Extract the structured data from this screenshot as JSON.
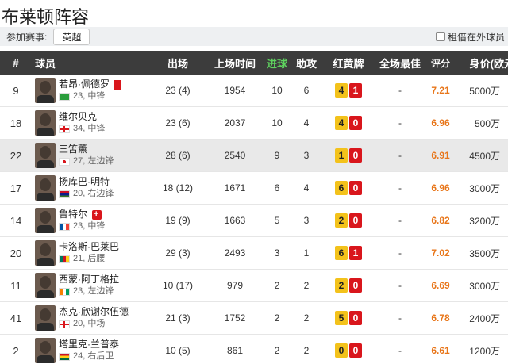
{
  "page_title": "布莱顿阵容",
  "filter": {
    "label": "参加赛事:",
    "league_button": "英超",
    "loan_checkbox_label": "租借在外球员"
  },
  "columns": {
    "num": "#",
    "player": "球员",
    "appearances": "出场",
    "minutes": "上场时间",
    "goals": "进球",
    "assists": "助攻",
    "cards": "红黄牌",
    "best": "全场最佳",
    "rating": "评分",
    "value": "身价(欧元)"
  },
  "colors": {
    "header_bg": "#3c3c3c",
    "goals_header": "#5fd35f",
    "yellow_card": "#f3c21b",
    "red_card": "#d9161c",
    "rating": "#e8761a",
    "trend_up": "#d9161c",
    "trend_flat": "#999999"
  },
  "players": [
    {
      "num": "9",
      "name": "若昂·佩德罗",
      "badge": "red-card",
      "flag": "brazil",
      "meta": "23, 中锋",
      "appearances": "23 (4)",
      "minutes": "1954",
      "goals": "10",
      "assists": "6",
      "yellow": "4",
      "red": "1",
      "best": "-",
      "rating": "7.21",
      "value": "5000万",
      "trend": "flat"
    },
    {
      "num": "18",
      "name": "维尔贝克",
      "badge": "",
      "flag": "england",
      "meta": "34, 中锋",
      "appearances": "23 (6)",
      "minutes": "2037",
      "goals": "10",
      "assists": "4",
      "yellow": "4",
      "red": "0",
      "best": "-",
      "rating": "6.96",
      "value": "500万",
      "trend": "flat"
    },
    {
      "num": "22",
      "name": "三笘薰",
      "badge": "",
      "flag": "japan",
      "meta": "27, 左边锋",
      "appearances": "28 (6)",
      "minutes": "2540",
      "goals": "9",
      "assists": "3",
      "yellow": "1",
      "red": "0",
      "best": "-",
      "rating": "6.91",
      "value": "4500万",
      "trend": "flat"
    },
    {
      "num": "17",
      "name": "扬库巴·明特",
      "badge": "",
      "flag": "gambia",
      "meta": "20, 右边锋",
      "appearances": "18 (12)",
      "minutes": "1671",
      "goals": "6",
      "assists": "4",
      "yellow": "6",
      "red": "0",
      "best": "-",
      "rating": "6.96",
      "value": "3000万",
      "trend": "up"
    },
    {
      "num": "14",
      "name": "鲁特尔",
      "badge": "injury",
      "flag": "france",
      "meta": "23, 中锋",
      "appearances": "19 (9)",
      "minutes": "1663",
      "goals": "5",
      "assists": "3",
      "yellow": "2",
      "red": "0",
      "best": "-",
      "rating": "6.82",
      "value": "3200万",
      "trend": "up"
    },
    {
      "num": "20",
      "name": "卡洛斯·巴莱巴",
      "badge": "",
      "flag": "cameroon",
      "meta": "21, 后腰",
      "appearances": "29 (3)",
      "minutes": "2493",
      "goals": "3",
      "assists": "1",
      "yellow": "6",
      "red": "1",
      "best": "-",
      "rating": "7.02",
      "value": "3500万",
      "trend": "up"
    },
    {
      "num": "11",
      "name": "西蒙·阿丁格拉",
      "badge": "",
      "flag": "ivory-coast",
      "meta": "23, 左边锋",
      "appearances": "10 (17)",
      "minutes": "979",
      "goals": "2",
      "assists": "2",
      "yellow": "2",
      "red": "0",
      "best": "-",
      "rating": "6.69",
      "value": "3000万",
      "trend": "up"
    },
    {
      "num": "41",
      "name": "杰克·欣谢尔伍德",
      "badge": "",
      "flag": "england",
      "meta": "20, 中场",
      "appearances": "21 (3)",
      "minutes": "1752",
      "goals": "2",
      "assists": "2",
      "yellow": "5",
      "red": "0",
      "best": "-",
      "rating": "6.78",
      "value": "2400万",
      "trend": "up"
    },
    {
      "num": "2",
      "name": "塔里克·兰普泰",
      "badge": "",
      "flag": "ghana",
      "meta": "24, 右后卫",
      "appearances": "10 (5)",
      "minutes": "861",
      "goals": "2",
      "assists": "2",
      "yellow": "0",
      "red": "0",
      "best": "-",
      "rating": "6.61",
      "value": "1200万",
      "trend": "flat"
    }
  ]
}
